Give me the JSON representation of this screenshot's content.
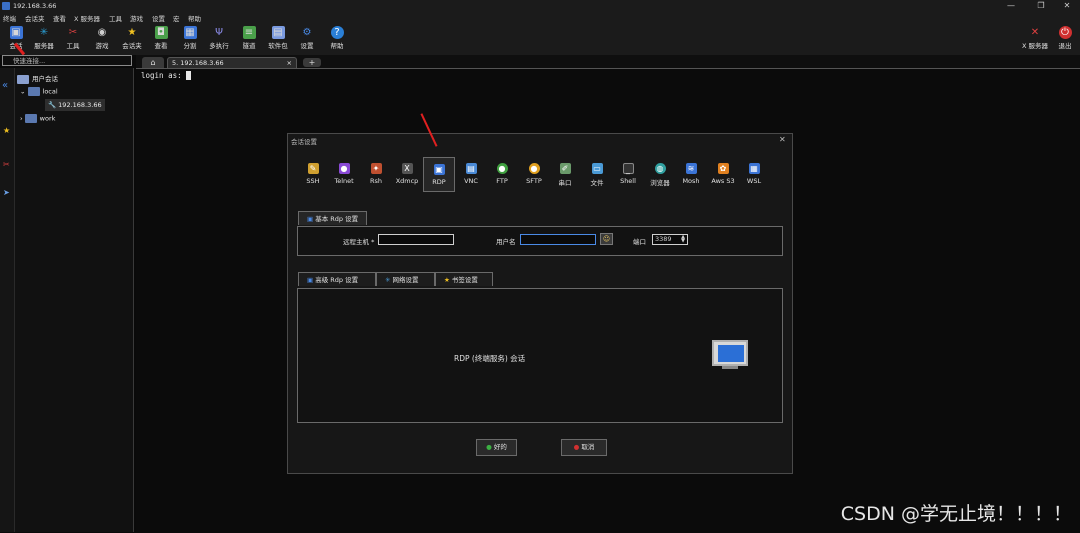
{
  "window": {
    "title": "192.168.3.66",
    "minimize": "—",
    "restore": "❐",
    "close": "✕"
  },
  "menu": [
    "终端",
    "会话夹",
    "查看",
    "X 服务器",
    "工具",
    "游戏",
    "设置",
    "宏",
    "帮助"
  ],
  "toolbar": [
    {
      "label": "会话",
      "icon": "session-icon",
      "color": "#3b74d6"
    },
    {
      "label": "服务器",
      "icon": "servers-icon",
      "color": "#2a9fd6"
    },
    {
      "label": "工具",
      "icon": "tools-icon",
      "color": "#d64040"
    },
    {
      "label": "游戏",
      "icon": "games-icon",
      "color": "#8a8a8a"
    },
    {
      "label": "会话夹",
      "icon": "star-icon",
      "color": "#f0c020"
    },
    {
      "label": "查看",
      "icon": "view-icon",
      "color": "#4aa04a"
    },
    {
      "label": "分割",
      "icon": "split-icon",
      "color": "#3b74d6"
    },
    {
      "label": "多执行",
      "icon": "multiexec-icon",
      "color": "#6a6ad6"
    },
    {
      "label": "隧道",
      "icon": "tunnel-icon",
      "color": "#4aa04a"
    },
    {
      "label": "软件包",
      "icon": "packages-icon",
      "color": "#7a9ae0"
    },
    {
      "label": "设置",
      "icon": "settings-icon",
      "color": "#3b74d6"
    },
    {
      "label": "帮助",
      "icon": "help-icon",
      "color": "#2a7fd6"
    }
  ],
  "toolbar_right": {
    "xserver": "X 服务器",
    "exit": "退出"
  },
  "search": {
    "placeholder": "快速连接..."
  },
  "tree": {
    "root": "用户会话",
    "folder_local": "local",
    "session": "192.168.3.66",
    "folder_work": "work"
  },
  "tabs": {
    "session_tab": "5. 192.168.3.66",
    "close": "×",
    "new": "+"
  },
  "terminal": {
    "prompt": "login as:"
  },
  "dialog": {
    "title": "会话设置",
    "close": "✕",
    "session_types": [
      {
        "label": "SSH",
        "icon": "ssh-icon",
        "color": "#d0a030"
      },
      {
        "label": "Telnet",
        "icon": "telnet-icon",
        "color": "#8a4ad6"
      },
      {
        "label": "Rsh",
        "icon": "rsh-icon",
        "color": "#c05030"
      },
      {
        "label": "Xdmcp",
        "icon": "xdmcp-icon",
        "color": "#555555"
      },
      {
        "label": "RDP",
        "icon": "rdp-icon",
        "color": "#3b74d6"
      },
      {
        "label": "VNC",
        "icon": "vnc-icon",
        "color": "#4a8ad6"
      },
      {
        "label": "FTP",
        "icon": "ftp-icon",
        "color": "#40a040"
      },
      {
        "label": "SFTP",
        "icon": "sftp-icon",
        "color": "#e0a020"
      },
      {
        "label": "串口",
        "icon": "serial-icon",
        "color": "#6a9a6a"
      },
      {
        "label": "文件",
        "icon": "file-icon",
        "color": "#4a9ad6"
      },
      {
        "label": "Shell",
        "icon": "shell-icon",
        "color": "#333333"
      },
      {
        "label": "浏览器",
        "icon": "browser-icon",
        "color": "#30a0a0"
      },
      {
        "label": "Mosh",
        "icon": "mosh-icon",
        "color": "#3b74d6"
      },
      {
        "label": "Aws S3",
        "icon": "aws-icon",
        "color": "#e08020"
      },
      {
        "label": "WSL",
        "icon": "wsl-icon",
        "color": "#3b74d6"
      }
    ],
    "basic_tab": "基本 Rdp 设置",
    "remote_host_label": "远程主机 *",
    "remote_host_value": "",
    "username_label": "用户名",
    "username_value": "",
    "port_label": "端口",
    "port_value": "3389",
    "lower_tabs": [
      "高级 Rdp 设置",
      "网络设置",
      "书签设置"
    ],
    "description": "RDP (终端服务) 会话",
    "ok": "好的",
    "cancel": "取消"
  },
  "watermark": "CSDN @学无止境！！！！",
  "colors": {
    "accent": "#3b74d6",
    "ok_green": "#3cb043",
    "cancel_red": "#d03030",
    "arrow": "#e02020"
  }
}
